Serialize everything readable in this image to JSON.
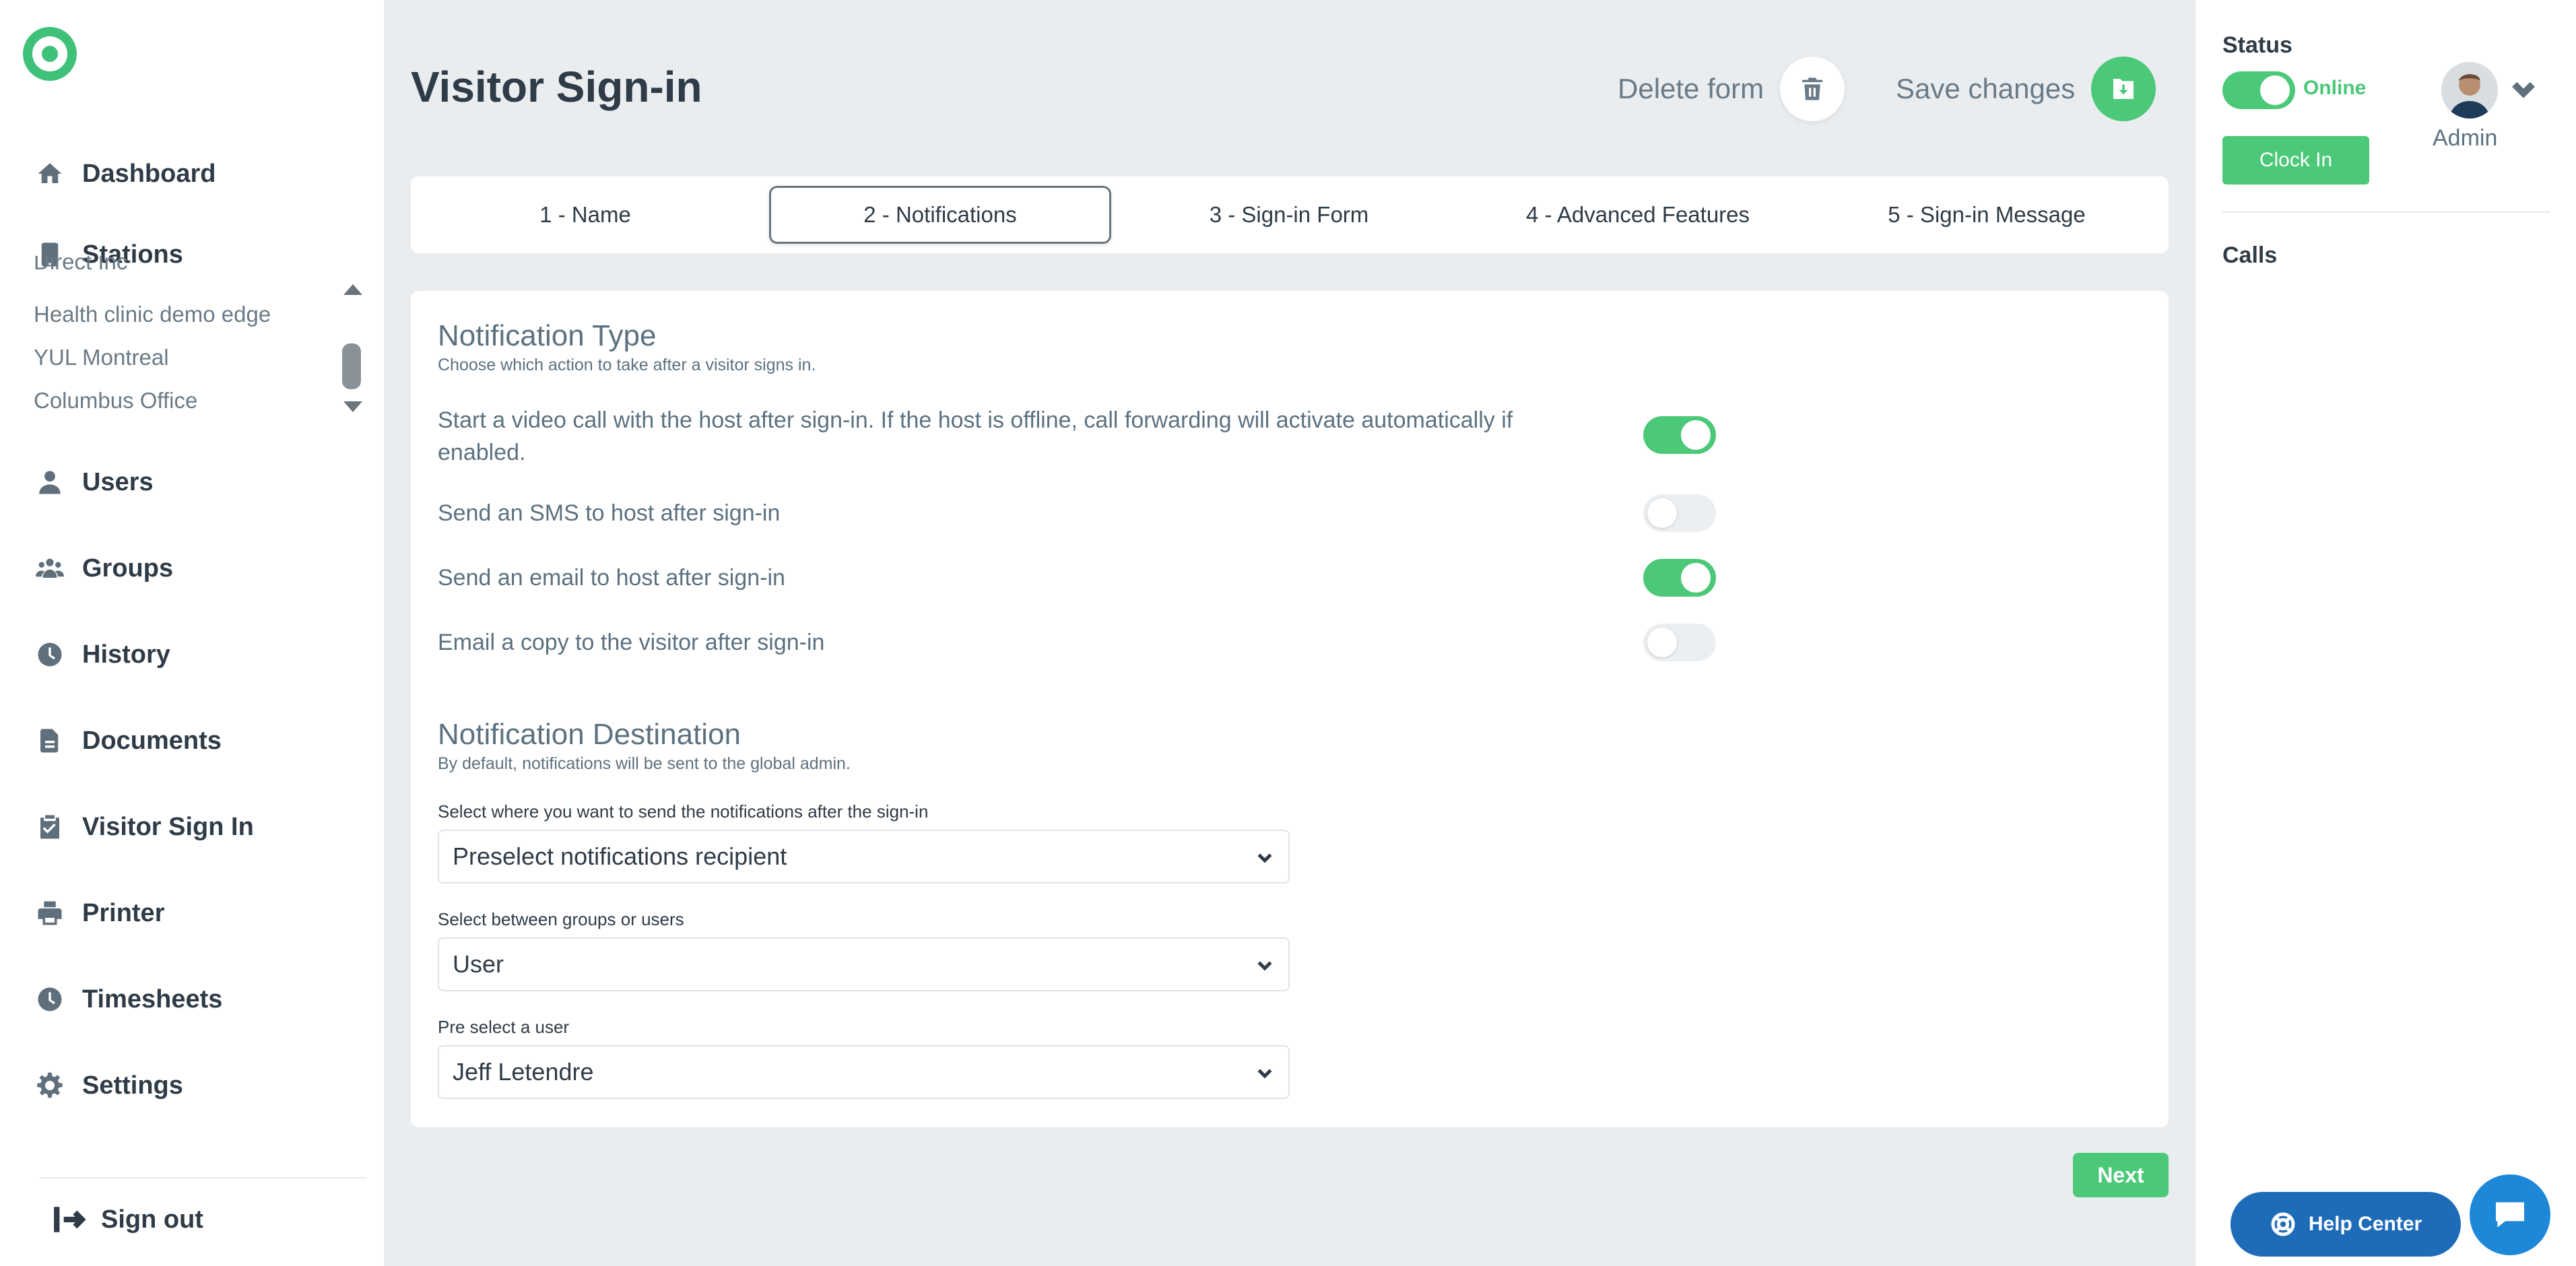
{
  "sidebar": {
    "nav": [
      {
        "label": "Dashboard",
        "icon": "home-icon"
      },
      {
        "label": "Stations",
        "icon": "tablet-icon"
      },
      {
        "label": "Users",
        "icon": "user-icon"
      },
      {
        "label": "Groups",
        "icon": "groups-icon"
      },
      {
        "label": "History",
        "icon": "clock-icon"
      },
      {
        "label": "Documents",
        "icon": "document-icon"
      },
      {
        "label": "Visitor Sign In",
        "icon": "clipboard-check-icon"
      },
      {
        "label": "Printer",
        "icon": "printer-icon"
      },
      {
        "label": "Timesheets",
        "icon": "clock-icon"
      },
      {
        "label": "Settings",
        "icon": "gear-icon"
      }
    ],
    "stations": [
      "Direct Inc",
      "Health clinic demo edge",
      "YUL Montreal",
      "Columbus Office"
    ],
    "signout_label": "Sign out"
  },
  "header": {
    "title": "Visitor Sign-in",
    "delete_label": "Delete form",
    "save_label": "Save changes"
  },
  "tabs": [
    {
      "label": "1 - Name",
      "active": false
    },
    {
      "label": "2 - Notifications",
      "active": true
    },
    {
      "label": "3 - Sign-in Form",
      "active": false
    },
    {
      "label": "4 - Advanced Features",
      "active": false
    },
    {
      "label": "5 - Sign-in Message",
      "active": false
    }
  ],
  "notification_type": {
    "title": "Notification Type",
    "subtitle": "Choose which action to take after a visitor signs in.",
    "options": [
      {
        "label": "Start a video call with the host after sign-in. If the host is offline, call forwarding will activate automatically if enabled.",
        "enabled": true
      },
      {
        "label": "Send an SMS to host after sign-in",
        "enabled": false
      },
      {
        "label": "Send an email to host after sign-in",
        "enabled": true
      },
      {
        "label": "Email a copy to the visitor after sign-in",
        "enabled": false
      }
    ]
  },
  "notification_destination": {
    "title": "Notification Destination",
    "subtitle": "By default, notifications will be sent to the global admin.",
    "fields": [
      {
        "label": "Select where you want to send the notifications after the sign-in",
        "value": "Preselect notifications recipient"
      },
      {
        "label": "Select between groups or users",
        "value": "User"
      },
      {
        "label": "Pre select a user",
        "value": "Jeff Letendre"
      }
    ]
  },
  "next_label": "Next",
  "right_panel": {
    "status_label": "Status",
    "online_label": "Online",
    "online": true,
    "clockin_label": "Clock In",
    "user_name": "Admin",
    "calls_label": "Calls"
  },
  "help_center_label": "Help Center",
  "colors": {
    "accent_green": "#4bc878",
    "help_blue": "#1e6bb8",
    "chat_blue": "#1e88d8"
  }
}
